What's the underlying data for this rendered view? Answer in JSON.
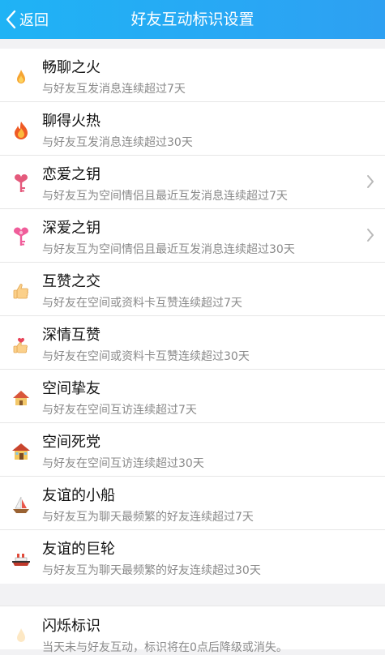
{
  "header": {
    "back_label": "返回",
    "title": "好友互动标识设置",
    "background": "#28a8f4"
  },
  "items": [
    {
      "name": "畅聊之火",
      "desc": "与好友互发消息连续超过7天",
      "icon": "small-flame-icon",
      "has_arrow": false
    },
    {
      "name": "聊得火热",
      "desc": "与好友互发消息连续超过30天",
      "icon": "big-flame-icon",
      "has_arrow": false
    },
    {
      "name": "恋爱之钥",
      "desc": "与好友互为空间情侣且最近互发消息连续超过7天",
      "icon": "love-key-icon",
      "has_arrow": true
    },
    {
      "name": "深爱之钥",
      "desc": "与好友互为空间情侣且最近互发消息连续超过30天",
      "icon": "deep-love-key-icon",
      "has_arrow": true
    },
    {
      "name": "互赞之交",
      "desc": "与好友在空间或资料卡互赞连续超过7天",
      "icon": "thumbs-up-icon",
      "has_arrow": false
    },
    {
      "name": "深情互赞",
      "desc": "与好友在空间或资料卡互赞连续超过30天",
      "icon": "thumbs-up-heart-icon",
      "has_arrow": false
    },
    {
      "name": "空间挚友",
      "desc": "与好友在空间互访连续超过7天",
      "icon": "house-icon",
      "has_arrow": false
    },
    {
      "name": "空间死党",
      "desc": "与好友在空间互访连续超过30天",
      "icon": "big-house-icon",
      "has_arrow": false
    },
    {
      "name": "友谊的小船",
      "desc": "与好友互为聊天最频繁的好友连续超过7天",
      "icon": "sailboat-icon",
      "has_arrow": false
    },
    {
      "name": "友谊的巨轮",
      "desc": "与好友互为聊天最频繁的好友连续超过30天",
      "icon": "ship-icon",
      "has_arrow": false
    }
  ],
  "flash": {
    "name": "闪烁标识",
    "desc": "当天未与好友互动，标识将在0点后降级或消失。",
    "icon": "flash-flame-icon"
  }
}
